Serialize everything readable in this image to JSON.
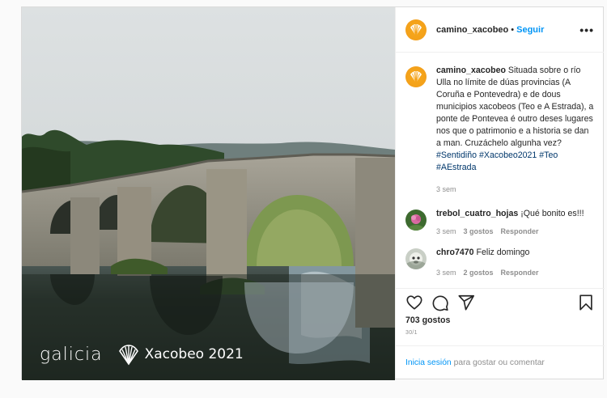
{
  "post": {
    "brand": {
      "galicia": "galicia",
      "xacobeo": "Xacobeo 2021"
    },
    "header": {
      "username": "camino_xacobeo",
      "separator": "•",
      "follow_label": "Seguir",
      "more_label": "•••"
    },
    "caption": {
      "username": "camino_xacobeo",
      "text": " Situada sobre o río Ulla no límite de dúas provincias (A Coruña e Pontevedra) e de dous municipios xacobeos (Teo e A Estrada), a ponte de Pontevea é outro deses lugares nos que o patrimonio e a historia se dan a man. Cruzáchelo algunha vez? ",
      "hashtags": [
        "#Sentidiño",
        "#Xacobeo2021",
        "#Teo",
        "#AEstrada"
      ],
      "time": "3 sem"
    },
    "comments": [
      {
        "username": "trebol_cuatro_hojas",
        "text": " ¡Qué bonito es!!!",
        "time": "3 sem",
        "likes": "3 gostos",
        "reply": "Responder"
      },
      {
        "username": "chro7470",
        "text": " Feliz domingo",
        "time": "3 sem",
        "likes": "2 gostos",
        "reply": "Responder"
      }
    ],
    "likes_count": "703 gostos",
    "date": "30/1",
    "login": {
      "link": "Inicia sesión",
      "text": "para gostar ou comentar"
    },
    "icons": {
      "like": "heart-icon",
      "comment": "comment-icon",
      "share": "share-icon",
      "save": "bookmark-icon",
      "avatar": "scallop-shell-icon"
    },
    "colors": {
      "link": "#0095f6",
      "hashtag": "#00376b",
      "muted": "#8e8e8e",
      "avatar": "#f4a21a"
    }
  }
}
